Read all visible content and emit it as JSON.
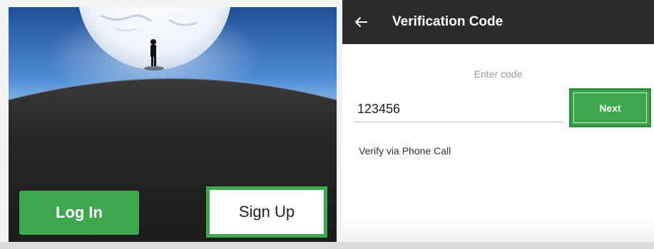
{
  "landing": {
    "login_label": "Log In",
    "signup_label": "Sign Up"
  },
  "verification": {
    "title": "Verification Code",
    "back_icon": "arrow-left-icon",
    "prompt": "Enter code",
    "code_value": "123456",
    "next_label": "Next",
    "phone_call_label": "Verify via Phone Call"
  },
  "colors": {
    "accent_green": "#3ea84e",
    "topbar": "#2b2b2b",
    "sky_blue": "#3a78c4",
    "ground": "#1e1e1e"
  }
}
